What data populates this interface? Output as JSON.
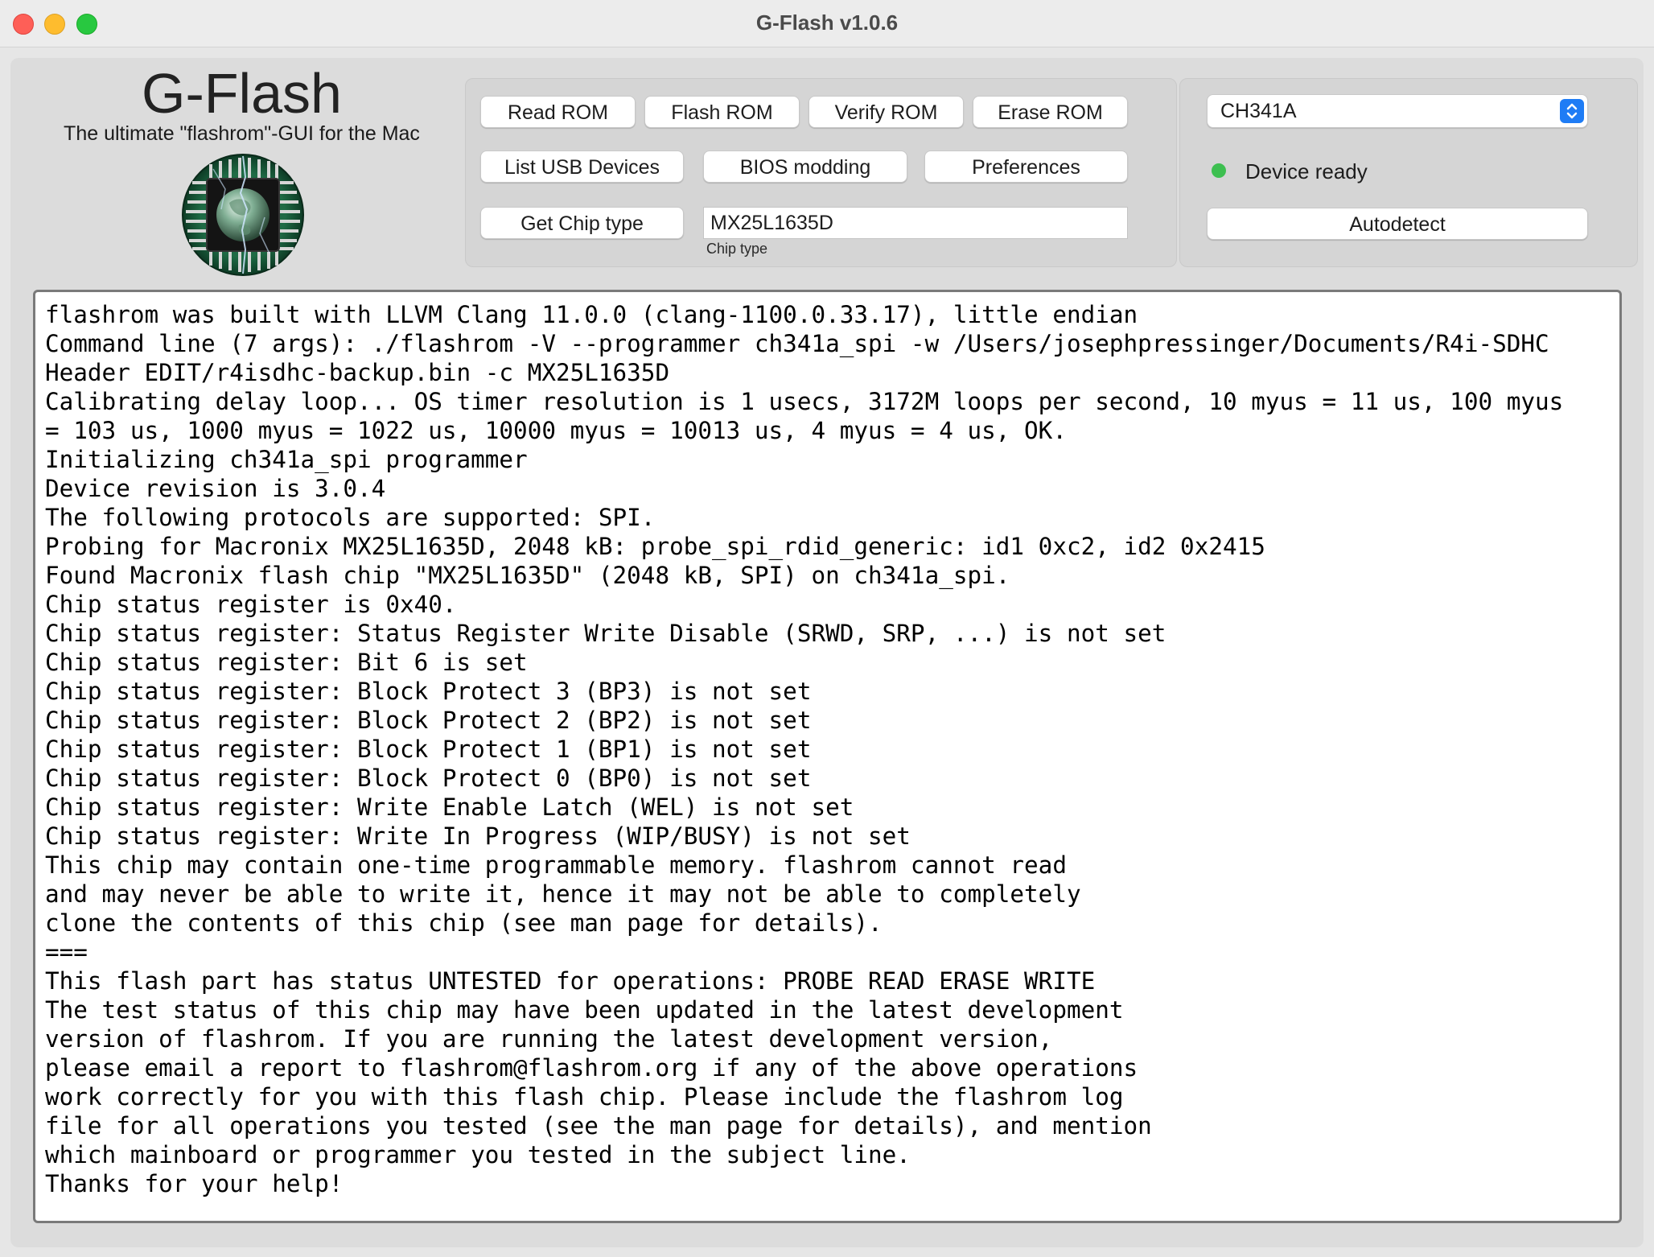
{
  "window": {
    "title": "G-Flash v1.0.6"
  },
  "branding": {
    "app_name": "G-Flash",
    "tagline": "The ultimate \"flashrom\"-GUI for the Mac",
    "logo_icon": "chip-globe-icon"
  },
  "actions": {
    "read_rom": "Read ROM",
    "flash_rom": "Flash ROM",
    "verify_rom": "Verify ROM",
    "erase_rom": "Erase ROM",
    "list_usb_devices": "List USB Devices",
    "bios_modding": "BIOS modding",
    "preferences": "Preferences",
    "get_chip_type": "Get Chip type"
  },
  "chip": {
    "value": "MX25L1635D",
    "label": "Chip type"
  },
  "device": {
    "programmer_selected": "CH341A",
    "status_text": "Device ready",
    "status_color": "#3dbf50",
    "autodetect_label": "Autodetect"
  },
  "log": {
    "lines": [
      "flashrom was built with LLVM Clang 11.0.0 (clang-1100.0.33.17), little endian",
      "Command line (7 args): ./flashrom -V --programmer ch341a_spi -w /Users/josephpressinger/Documents/R4i-SDHC",
      "Header EDIT/r4isdhc-backup.bin -c MX25L1635D",
      "Calibrating delay loop... OS timer resolution is 1 usecs, 3172M loops per second, 10 myus = 11 us, 100 myus",
      "= 103 us, 1000 myus = 1022 us, 10000 myus = 10013 us, 4 myus = 4 us, OK.",
      "Initializing ch341a_spi programmer",
      "Device revision is 3.0.4",
      "The following protocols are supported: SPI.",
      "Probing for Macronix MX25L1635D, 2048 kB: probe_spi_rdid_generic: id1 0xc2, id2 0x2415",
      "Found Macronix flash chip \"MX25L1635D\" (2048 kB, SPI) on ch341a_spi.",
      "Chip status register is 0x40.",
      "Chip status register: Status Register Write Disable (SRWD, SRP, ...) is not set",
      "Chip status register: Bit 6 is set",
      "Chip status register: Block Protect 3 (BP3) is not set",
      "Chip status register: Block Protect 2 (BP2) is not set",
      "Chip status register: Block Protect 1 (BP1) is not set",
      "Chip status register: Block Protect 0 (BP0) is not set",
      "Chip status register: Write Enable Latch (WEL) is not set",
      "Chip status register: Write In Progress (WIP/BUSY) is not set",
      "This chip may contain one-time programmable memory. flashrom cannot read",
      "and may never be able to write it, hence it may not be able to completely",
      "clone the contents of this chip (see man page for details).",
      "===",
      "This flash part has status UNTESTED for operations: PROBE READ ERASE WRITE",
      "The test status of this chip may have been updated in the latest development",
      "version of flashrom. If you are running the latest development version,",
      "please email a report to flashrom@flashrom.org if any of the above operations",
      "work correctly for you with this flash chip. Please include the flashrom log",
      "file for all operations you tested (see the man page for details), and mention",
      "which mainboard or programmer you tested in the subject line.",
      "Thanks for your help!"
    ]
  }
}
